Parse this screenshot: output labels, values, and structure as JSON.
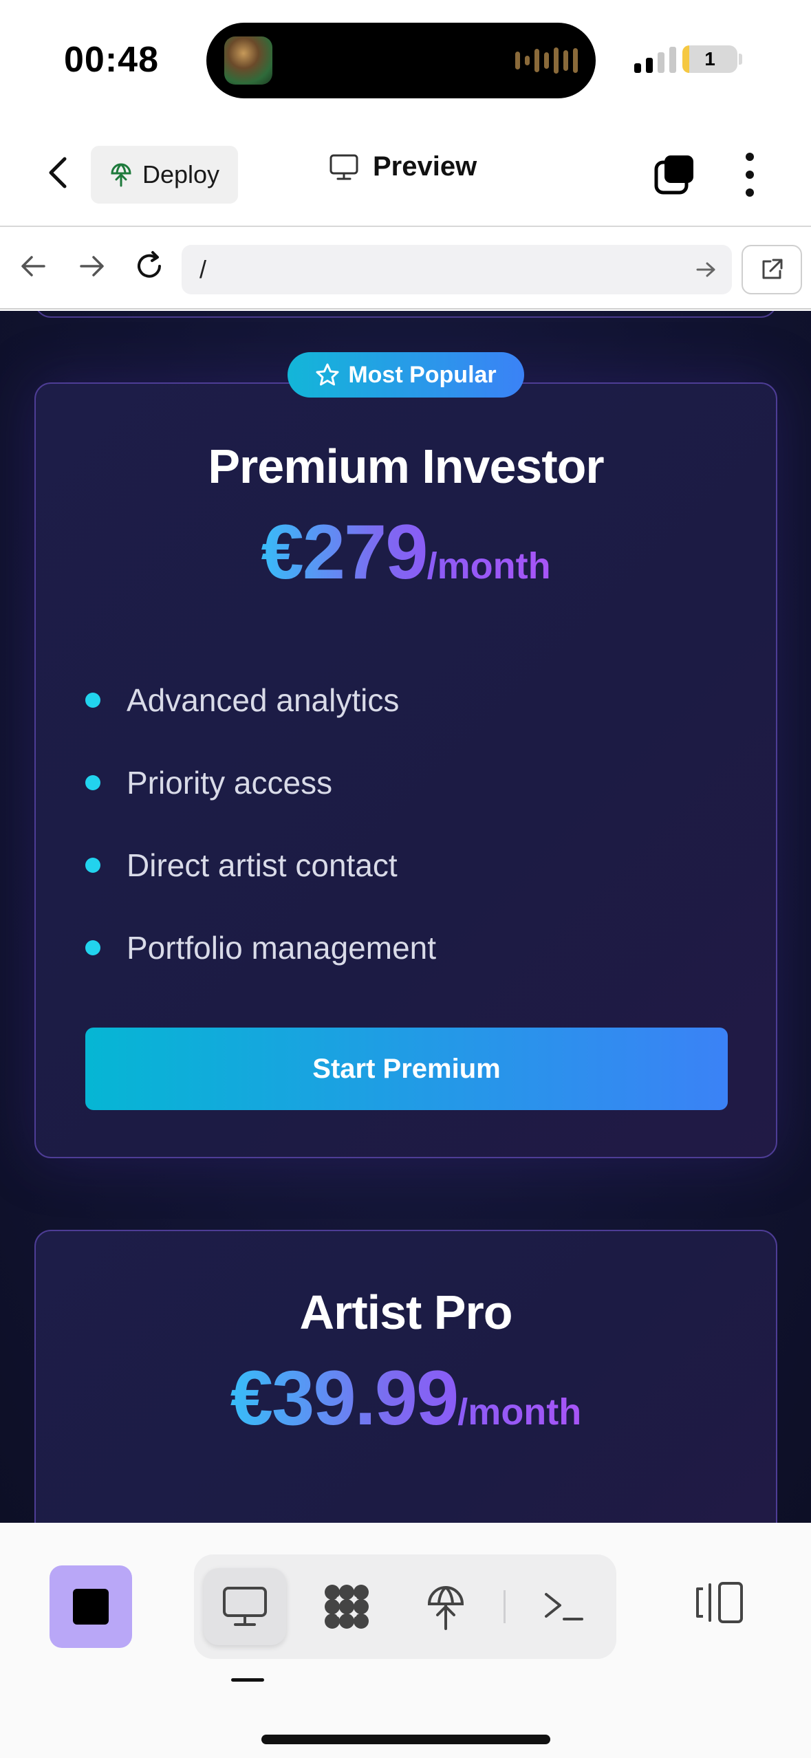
{
  "status_bar": {
    "time": "00:48",
    "battery_level": "1",
    "battery_color": "#f5c842",
    "signal_bars_active": 2,
    "signal_bars_total": 4
  },
  "header": {
    "deploy_label": "Deploy",
    "title": "Preview",
    "icons": [
      "chevron-left-icon",
      "globe-icon",
      "monitor-icon",
      "tabs-icon",
      "more-vertical-icon"
    ]
  },
  "browser": {
    "url": "/",
    "icons": [
      "arrow-left-icon",
      "arrow-right-icon",
      "reload-icon",
      "arrow-go-icon",
      "external-link-icon"
    ]
  },
  "plans": [
    {
      "badge": "Most Popular",
      "name": "Premium Investor",
      "price": "€279",
      "period": "/month",
      "features": [
        "Advanced analytics",
        "Priority access",
        "Direct artist contact",
        "Portfolio management"
      ],
      "cta": "Start Premium"
    },
    {
      "name": "Artist Pro",
      "price": "€39.99",
      "period": "/month"
    }
  ],
  "colors": {
    "background": "#121433",
    "card_border": "#4e3d96",
    "accent_cyan": "#22d3ee",
    "accent_blue": "#3b82f6",
    "accent_purple": "#8b5cf6",
    "stop_button": "#b9a7f7"
  },
  "toolbar": {
    "active_tool": "preview",
    "tools": [
      "monitor-icon",
      "apps-icon",
      "deploy-icon",
      "terminal-icon"
    ],
    "extra_icons": [
      "stop-icon",
      "panel-toggle-icon"
    ]
  }
}
